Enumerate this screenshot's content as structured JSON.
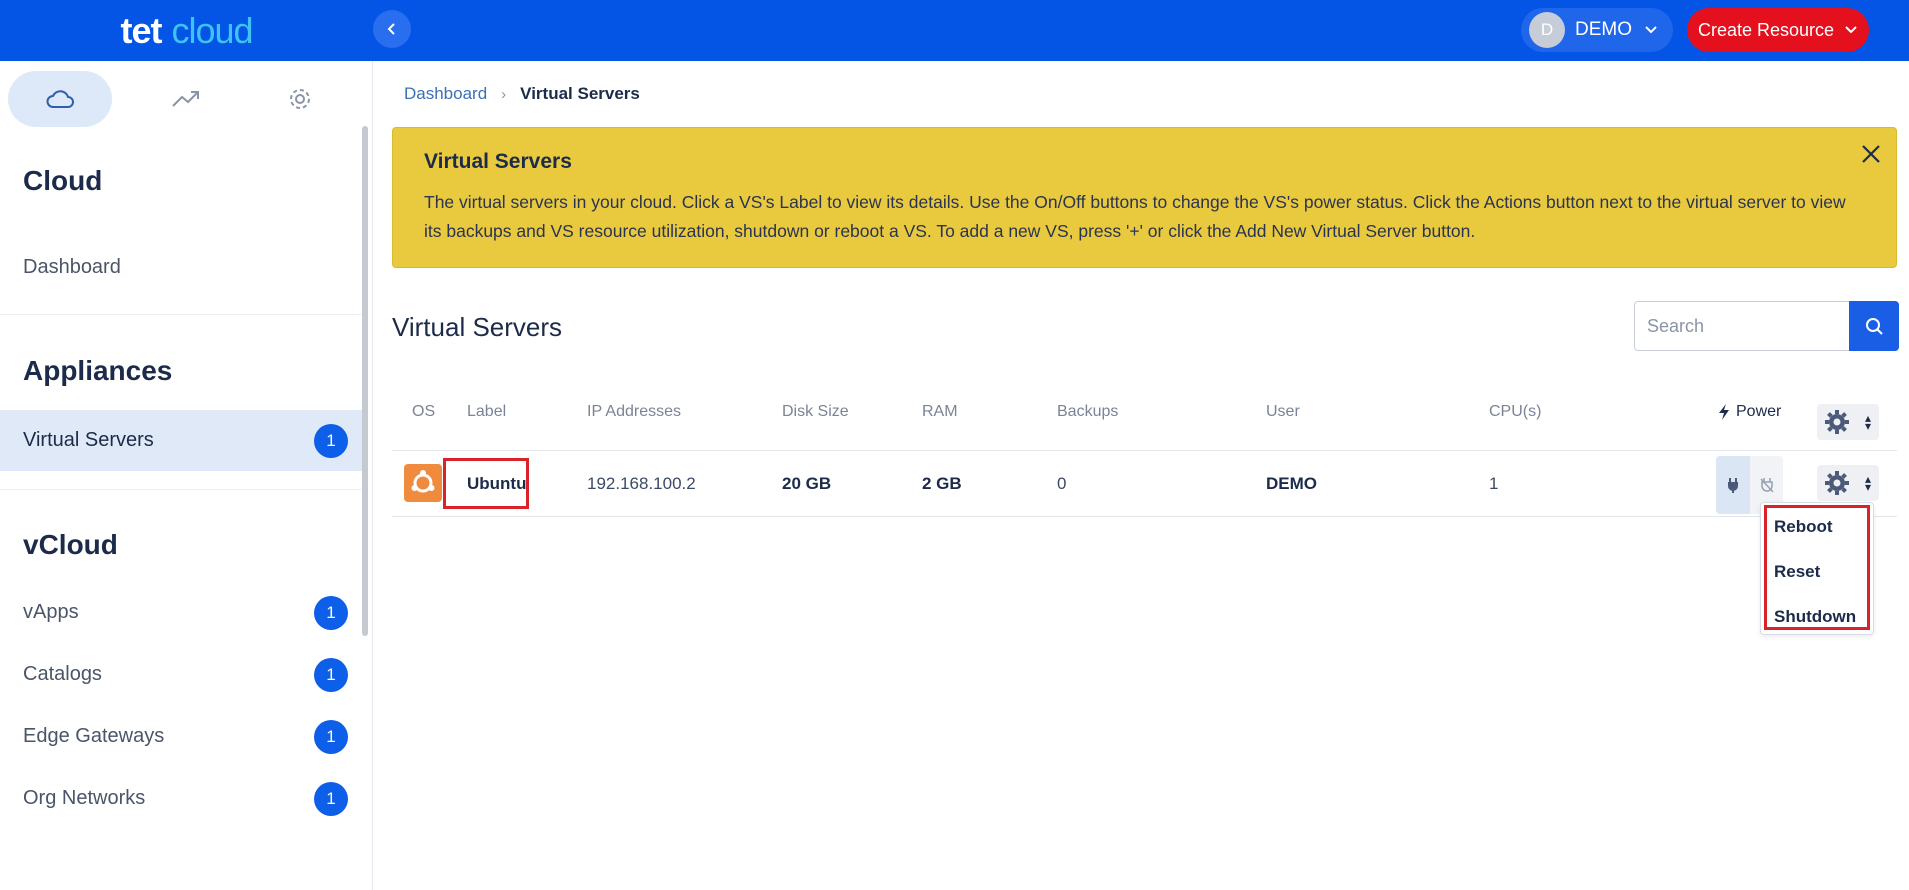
{
  "brand": {
    "part1": "tet",
    "part2": "cloud"
  },
  "header": {
    "user_initial": "D",
    "user_name": "DEMO",
    "create_label": "Create Resource"
  },
  "sidebar": {
    "sections": [
      {
        "title": "Cloud",
        "items": [
          {
            "label": "Dashboard"
          }
        ]
      },
      {
        "title": "Appliances",
        "items": [
          {
            "label": "Virtual Servers",
            "badge": "1"
          }
        ]
      },
      {
        "title": "vCloud",
        "items": [
          {
            "label": "vApps",
            "badge": "1"
          },
          {
            "label": "Catalogs",
            "badge": "1"
          },
          {
            "label": "Edge Gateways",
            "badge": "1"
          },
          {
            "label": "Org Networks",
            "badge": "1"
          }
        ]
      }
    ]
  },
  "breadcrumb": {
    "parent": "Dashboard",
    "current": "Virtual Servers"
  },
  "banner": {
    "title": "Virtual Servers",
    "text": "The virtual servers in your cloud. Click a VS's Label to view its details. Use the On/Off buttons to change the VS's power status. Click the Actions button next to the virtual server to view its backups and VS resource utilization, shutdown or reboot a VS. To add a new VS, press '+' or click the Add New Virtual Server button."
  },
  "page_title": "Virtual Servers",
  "search": {
    "placeholder": "Search"
  },
  "table": {
    "headers": [
      "OS",
      "Label",
      "IP Addresses",
      "Disk Size",
      "RAM",
      "Backups",
      "User",
      "CPU(s)",
      "Power"
    ],
    "rows": [
      {
        "label": "Ubuntu",
        "ip": "192.168.100.2",
        "disk": "20 GB",
        "ram": "2 GB",
        "backups": "0",
        "user": "DEMO",
        "cpus": "1"
      }
    ]
  },
  "actions_menu": [
    "Reboot",
    "Reset",
    "Shutdown"
  ],
  "colors": {
    "topbar": "#0455e6",
    "create": "#e4101e",
    "banner": "#e9c93e",
    "badge": "#0d5ee8",
    "highlight": "#d8232a"
  }
}
